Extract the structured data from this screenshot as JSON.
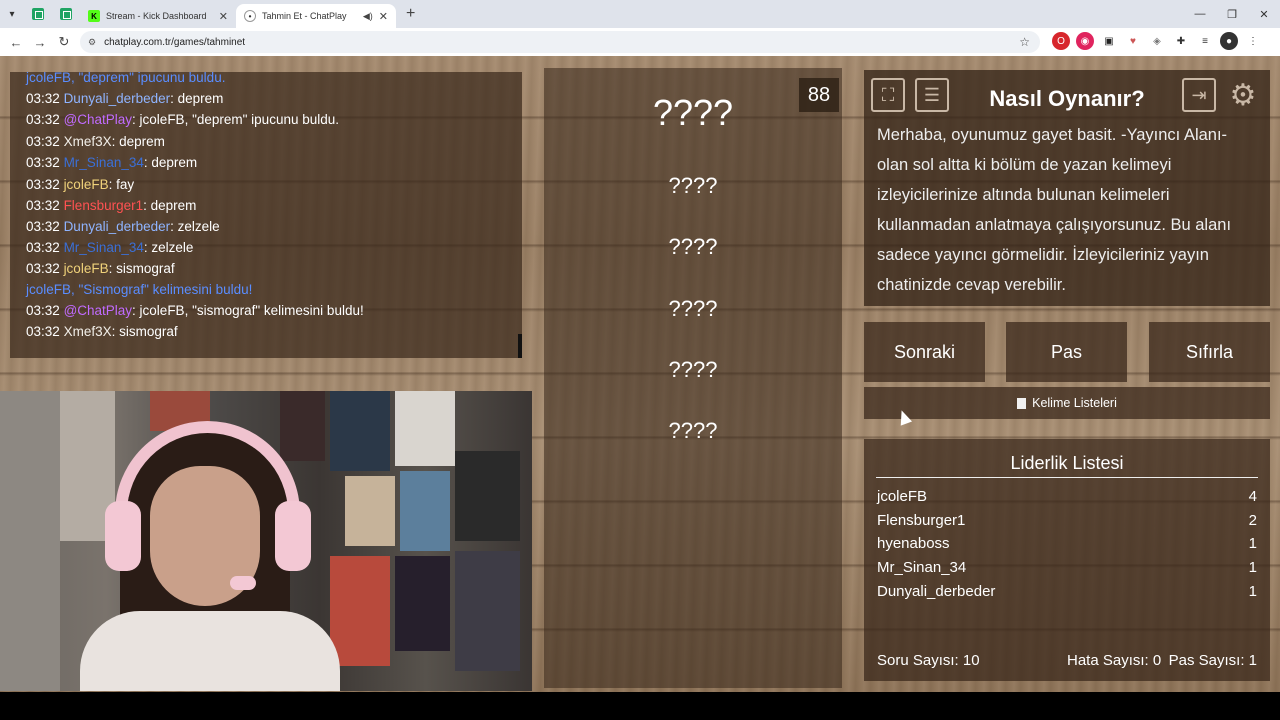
{
  "browser": {
    "tabs": [
      {
        "title": "Stream - Kick Dashboard",
        "active": false
      },
      {
        "title": "Tahmin Et - ChatPlay",
        "active": true
      }
    ],
    "url": "chatplay.com.tr/games/tahminet"
  },
  "chat": {
    "lines": [
      {
        "time": "",
        "user": "jcoleFB",
        "msg": ", \"deprem\" ipucunu buldu.",
        "system": true
      },
      {
        "time": "03:32",
        "user": "Dunyali_derbeder",
        "msg": ": deprem"
      },
      {
        "time": "03:32",
        "user": "@ChatPlay",
        "msg": ": jcoleFB, \"deprem\" ipucunu buldu."
      },
      {
        "time": "03:32",
        "user": "Xmef3X",
        "msg": ": deprem"
      },
      {
        "time": "03:32",
        "user": "Mr_Sinan_34",
        "msg": ": deprem"
      },
      {
        "time": "03:32",
        "user": "jcoleFB",
        "msg": ": fay"
      },
      {
        "time": "03:32",
        "user": "Flensburger1",
        "msg": ": deprem"
      },
      {
        "time": "03:32",
        "user": "Dunyali_derbeder",
        "msg": ": zelzele"
      },
      {
        "time": "03:32",
        "user": "Mr_Sinan_34",
        "msg": ": zelzele"
      },
      {
        "time": "03:32",
        "user": "jcoleFB",
        "msg": ": sismograf"
      },
      {
        "time": "",
        "user": "jcoleFB, \"Sismograf\" kelimesini buldu!",
        "msg": "",
        "system": true
      },
      {
        "time": "03:32",
        "user": "@ChatPlay",
        "msg": ": jcoleFB, \"sismograf\" kelimesini buldu!"
      },
      {
        "time": "03:32",
        "user": "Xmef3X",
        "msg": ": sismograf"
      }
    ],
    "colors": {
      "jcoleFB": "#f0d27a",
      "Dunyali_derbeder": "#8fb4ff",
      "@ChatPlay": "#c16bff",
      "Xmef3X": "#f2efe9",
      "Mr_Sinan_34": "#3b6fd6",
      "Flensburger1": "#ff5252",
      "system": "#5a8dff"
    }
  },
  "game": {
    "main_word": "????",
    "hints": [
      "????",
      "????",
      "????",
      "????",
      "????"
    ],
    "timer": "88"
  },
  "howto": {
    "title": "Nasıl Oynanır?",
    "text": "Merhaba, oyunumuz gayet basit. -Yayıncı Alanı- olan sol altta ki bölüm de yazan kelimeyi izleyicilerinize altında bulunan kelimeleri kullanmadan anlatmaya çalışıyorsunuz. Bu alanı sadece yayıncı görmelidir. İzleyicileriniz yayın chatinizde cevap verebilir."
  },
  "controls": {
    "next": "Sonraki",
    "pass": "Pas",
    "reset": "Sıfırla",
    "word_lists": "Kelime Listeleri"
  },
  "leaderboard": {
    "title": "Liderlik Listesi",
    "rows": [
      {
        "name": "jcoleFB",
        "score": "4"
      },
      {
        "name": "Flensburger1",
        "score": "2"
      },
      {
        "name": "hyenaboss",
        "score": "1"
      },
      {
        "name": "Mr_Sinan_34",
        "score": "1"
      },
      {
        "name": "Dunyali_derbeder",
        "score": "1"
      }
    ],
    "question_count": "Soru Sayısı: 10",
    "error_count": "Hata Sayısı: 0",
    "pass_count": "Pas Sayısı: 1"
  },
  "icons": [
    "fullscreen-icon",
    "list-icon",
    "exit-icon",
    "gear-icon"
  ]
}
